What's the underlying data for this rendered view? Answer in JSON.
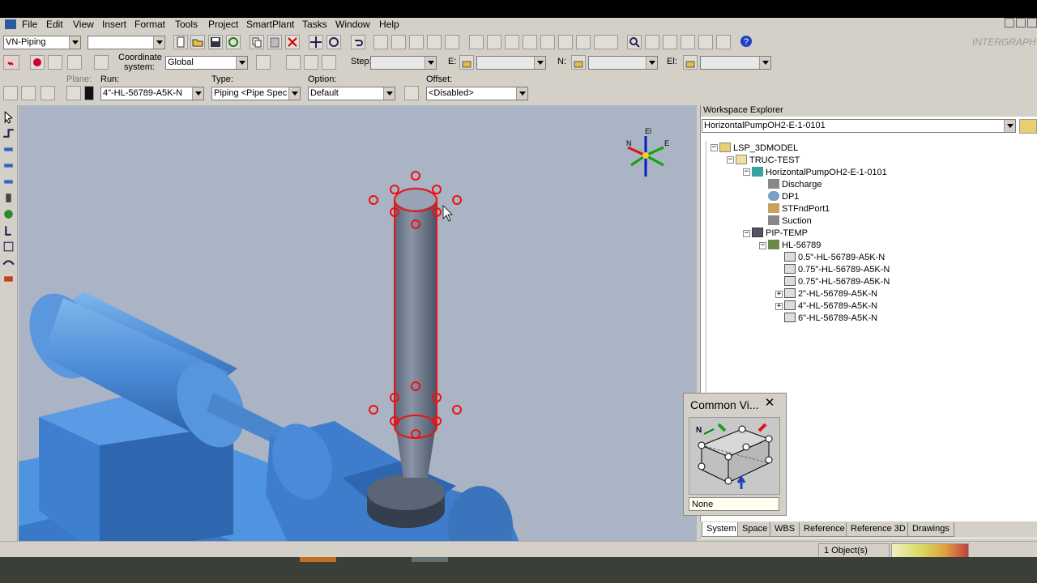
{
  "menu": [
    "File",
    "Edit",
    "View",
    "Insert",
    "Format",
    "Tools",
    "Project",
    "SmartPlant",
    "Tasks",
    "Window",
    "Help"
  ],
  "toolbar1": {
    "task_select": "VN-Piping",
    "filter_select": "",
    "logo_text": "INTERGRAPH"
  },
  "toolbar2": {
    "coord_label": "Coordinate system:",
    "coord_value": "Global",
    "step_label": "Step:",
    "step_value": "",
    "e_label": "E:",
    "e_value": "",
    "n_label": "N:",
    "n_value": "",
    "el_label": "El:",
    "el_value": ""
  },
  "toolbar3": {
    "plane_label": "Plane:",
    "run_label": "Run:",
    "run_value": "4\"-HL-56789-A5K-N",
    "type_label": "Type:",
    "type_value": "Piping <Pipe Spec F",
    "option_label": "Option:",
    "option_value": "Default",
    "offset_label": "Offset:",
    "offset_value": "<Disabled>"
  },
  "compass": {
    "el": "El",
    "n": "N",
    "e": "E"
  },
  "workspace": {
    "title": "Workspace Explorer",
    "filter": "HorizontalPumpOH2-E-1-0101",
    "tree": {
      "root": "LSP_3DMODEL",
      "truc": "TRUC-TEST",
      "pump": "HorizontalPumpOH2-E-1-0101",
      "discharge": "Discharge",
      "dp1": "DP1",
      "stfnd": "STFndPort1",
      "suction": "Suction",
      "piptemp": "PIP-TEMP",
      "hl": "HL-56789",
      "runs": [
        "0.5\"-HL-56789-A5K-N",
        "0.75\"-HL-56789-A5K-N",
        "0.75\"-HL-56789-A5K-N",
        "2\"-HL-56789-A5K-N",
        "4\"-HL-56789-A5K-N",
        "6\"-HL-56789-A5K-N"
      ]
    },
    "tabs": [
      "System",
      "Space",
      "WBS",
      "Reference",
      "Reference 3D",
      "Drawings"
    ],
    "active_tab": "System"
  },
  "common_views": {
    "title": "Common Vi...",
    "close": "✕",
    "value": "None",
    "n_label": "N"
  },
  "status": {
    "objects": "1 Object(s)"
  },
  "colors": {
    "accent_red": "#ee1111",
    "pipe_blue": "#5b9bd5",
    "viewport_bg": "#aab4c4"
  }
}
